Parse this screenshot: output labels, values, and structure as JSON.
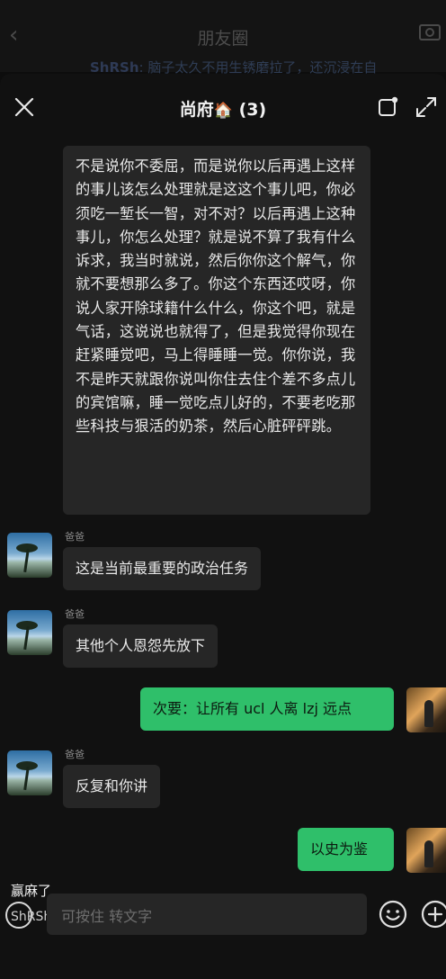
{
  "background_page": {
    "title": "朋友圈",
    "comment_name": "ShRSh",
    "comment_text": ": 脑子太久不用生锈磨拉了，还沉浸在自"
  },
  "header": {
    "title": "尚府",
    "emoji": "🏠",
    "count": "(3)"
  },
  "messages": {
    "long_text": "不是说你不委屈，而是说你以后再遇上这样的事儿该怎么处理就是这这个事儿吧，你必须吃一堑长一智，对不对？以后再遇上这种事儿，你怎么处理？就是说不算了我有什么诉求，我当时就说，然后你你这个解气，你就不要想那么多了。你这个东西还哎呀，你说人家开除球籍什么什么，你这个吧，就是气话，这说说也就得了，但是我觉得你现在赶紧睡觉吧，马上得睡睡一觉。你你说，我不是昨天就跟你说叫你住去住个差不多点儿的宾馆嘛，睡一觉吃点儿好的，不要老吃那些科技与狠活的奶茶，然后心脏砰砰跳。",
    "m1_sender": "爸爸",
    "m1_text": "这是当前最重要的政治任务",
    "m2_sender": "爸爸",
    "m2_text": "其他个人恩怨先放下",
    "m3_text": "次要：让所有 ucl 人离 lzj 远点",
    "m4_sender": "爸爸",
    "m4_text": "反复和你讲",
    "m5_text": "以史为鉴"
  },
  "bottom": {
    "top_label": "赢麻了",
    "overlay_name": "ShRSh",
    "input_placeholder": "可按住 转文字"
  },
  "colors": {
    "accent_green": "#2fbf6a",
    "bubble_gray": "#262626",
    "background": "#111111"
  },
  "icons": [
    "back-icon",
    "camera-icon",
    "close-icon",
    "float-window-icon",
    "expand-icon",
    "voice-icon",
    "emoji-icon",
    "plus-icon"
  ]
}
